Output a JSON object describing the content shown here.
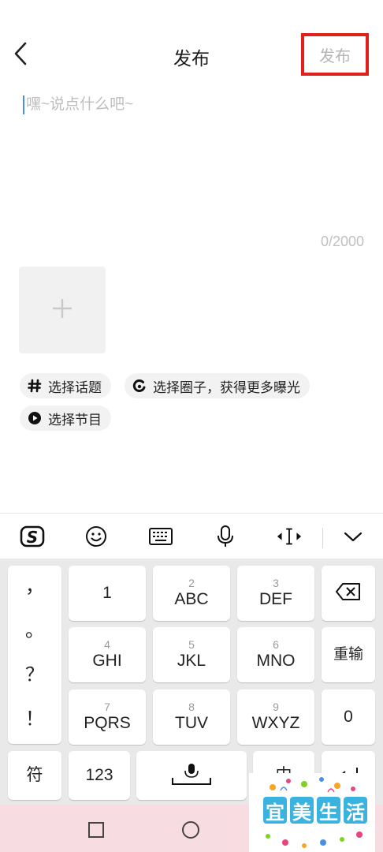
{
  "header": {
    "title": "发布",
    "publish_label": "发布",
    "back_icon": "chevron-left-icon",
    "highlight_color": "#e0201b"
  },
  "editor": {
    "placeholder": "嘿~说点什么吧~",
    "value": "",
    "counter": "0/2000"
  },
  "media": {
    "add_icon": "plus-icon"
  },
  "chips": [
    {
      "icon": "hashtag-icon",
      "label": "选择话题"
    },
    {
      "icon": "circle-swirl-icon",
      "label": "选择圈子，获得更多曝光"
    },
    {
      "icon": "play-icon",
      "label": "选择节目"
    }
  ],
  "keyboard_toolbar": {
    "items": [
      "sogou-logo-icon",
      "emoji-icon",
      "keyboard-icon",
      "microphone-icon",
      "cursor-move-icon",
      "chevron-down-icon"
    ]
  },
  "keyboard": {
    "punctuation": [
      "，",
      "。",
      "？",
      "！"
    ],
    "keys": [
      {
        "sup": "",
        "main": "1"
      },
      {
        "sup": "2",
        "main": "ABC"
      },
      {
        "sup": "3",
        "main": "DEF"
      },
      {
        "sup": "4",
        "main": "GHI"
      },
      {
        "sup": "5",
        "main": "JKL"
      },
      {
        "sup": "6",
        "main": "MNO"
      },
      {
        "sup": "7",
        "main": "PQRS"
      },
      {
        "sup": "8",
        "main": "TUV"
      },
      {
        "sup": "9",
        "main": "WXYZ"
      }
    ],
    "reenter": "重输",
    "zero": "0",
    "symbol": "符",
    "num": "123",
    "lang": "中",
    "backspace_icon": "backspace-icon",
    "space_mic_icon": "microphone-icon"
  },
  "navbar": {
    "items": [
      "square-icon",
      "circle-icon"
    ]
  },
  "watermark": {
    "text": [
      "宜",
      "美",
      "生",
      "活"
    ],
    "colors": [
      "#3bb3e0",
      "#3bb3e0",
      "#3bb3e0",
      "#3bb3e0"
    ]
  }
}
